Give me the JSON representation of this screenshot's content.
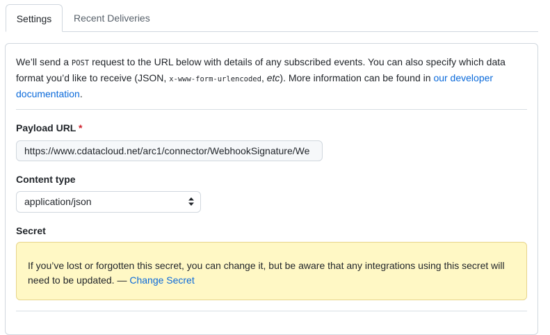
{
  "tabs": {
    "settings": "Settings",
    "recent_deliveries": "Recent Deliveries"
  },
  "intro": {
    "part1": "We’ll send a ",
    "code_post": "POST",
    "part2": " request to the URL below with details of any subscribed events. You can also specify which data format you’d like to receive (JSON, ",
    "code_form": "x-www-form-urlencoded",
    "part3": ", ",
    "etc": "etc",
    "part4": "). More information can be found in ",
    "link": "our developer documentation",
    "part5": "."
  },
  "payload_url": {
    "label": "Payload URL",
    "required_mark": "*",
    "value": "https://www.cdatacloud.net/arc1/connector/WebhookSignature/We"
  },
  "content_type": {
    "label": "Content type",
    "selected": "application/json"
  },
  "secret": {
    "label": "Secret",
    "notice": "If you’ve lost or forgotten this secret, you can change it, but be aware that any integrations using this secret will need to be updated. — ",
    "change_link": "Change Secret"
  },
  "colors": {
    "link": "#0969da",
    "required": "#cf222e",
    "flash_bg": "#fff8c5",
    "flash_border": "#e7d48b",
    "border": "#d0d7de"
  }
}
